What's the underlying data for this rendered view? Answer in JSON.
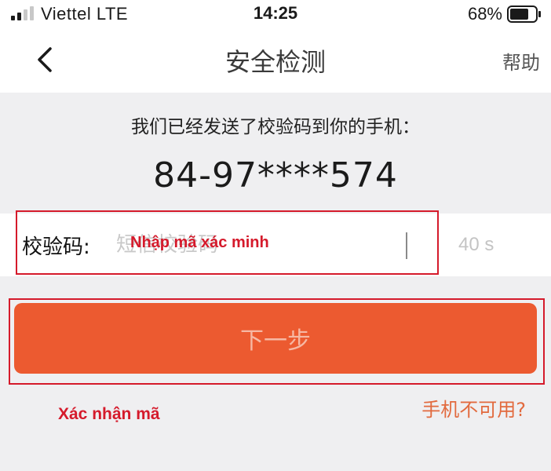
{
  "status_bar": {
    "carrier": "Viettel  LTE",
    "time": "14:25",
    "battery": "68%"
  },
  "nav": {
    "title": "安全检测",
    "help": "帮助",
    "back_icon": "chevron-left-icon"
  },
  "verification": {
    "message": "我们已经发送了校验码到你的手机：",
    "phone_number": "84-97****574",
    "code_label": "校验码:",
    "code_placeholder": "短信校验码",
    "countdown": "40 s"
  },
  "next_button": {
    "label": "下一步"
  },
  "phone_unavailable_link": "手机不可用?",
  "annotations": {
    "input_note": "Nhập mã xác minh",
    "confirm_note": "Xác nhận mã",
    "color": "#d51a2b"
  },
  "colors": {
    "primary_button": "#ec5a30",
    "link": "#e26a3e",
    "background": "#efeff1"
  }
}
